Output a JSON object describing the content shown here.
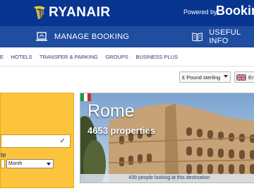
{
  "header": {
    "brand": "RYANAIR",
    "powered_by": "Powered by",
    "partner": "Booking"
  },
  "nav": {
    "items": [
      {
        "label": "MANAGE BOOKING",
        "icon": "laptop-icon"
      },
      {
        "label": "USEFUL INFO",
        "icon": "book-icon"
      }
    ]
  },
  "submenu": {
    "items": [
      "E",
      "HOTELS",
      "TRANSFER & PARKING",
      "GROUPS",
      "BUSINESS PLUS"
    ],
    "separator": "·"
  },
  "currency": {
    "selected": "£ Pound sterling"
  },
  "language": {
    "selected": "En"
  },
  "search": {
    "date_label": "te",
    "month_placeholder": "Month"
  },
  "destination": {
    "city": "Rome",
    "properties": "4653 properties",
    "looking": "439 people looking at this destination"
  },
  "colors": {
    "header_bg": "#073590",
    "nav_bg": "#1f4ea0",
    "search_panel": "#fcc43c"
  }
}
